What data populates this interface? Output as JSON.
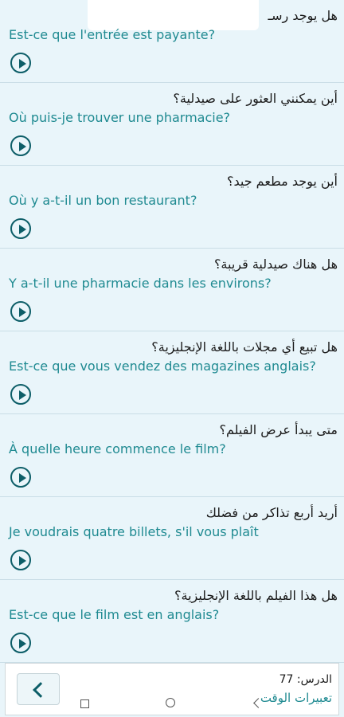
{
  "phrases": [
    {
      "ar": "هل يوجد رسـ",
      "fr": "Est-ce que l'entrée est payante?"
    },
    {
      "ar": "أين يمكنني العثور على صيدلية؟",
      "fr": "Où puis-je trouver une pharmacie?"
    },
    {
      "ar": "أين يوجد مطعم جيد؟",
      "fr": "Où y a-t-il un bon restaurant?"
    },
    {
      "ar": "هل هناك صيدلية قريبة؟",
      "fr": "Y a-t-il une pharmacie dans les environs?"
    },
    {
      "ar": "هل تبيع أي مجلات باللغة الإنجليزية؟",
      "fr": "Est-ce que vous vendez des magazines anglais?"
    },
    {
      "ar": "متى يبدأ عرض الفيلم؟",
      "fr": "À quelle heure commence le film?"
    },
    {
      "ar": "أريد أربع تذاكر من فضلك",
      "fr": "Je voudrais quatre billets, s'il vous plaît"
    },
    {
      "ar": "هل هذا الفيلم باللغة الإنجليزية؟",
      "fr": "Est-ce que le film est en anglais?"
    }
  ],
  "footer": {
    "lesson_label": "الدرس: 77",
    "lesson_title": "تعبيرات الوقت"
  },
  "icons": {
    "play": "play-circle-icon",
    "back": "chevron-left-icon"
  },
  "colors": {
    "background": "#e9f5fa",
    "french_text": "#1f8a91",
    "accent": "#0d5e68"
  }
}
